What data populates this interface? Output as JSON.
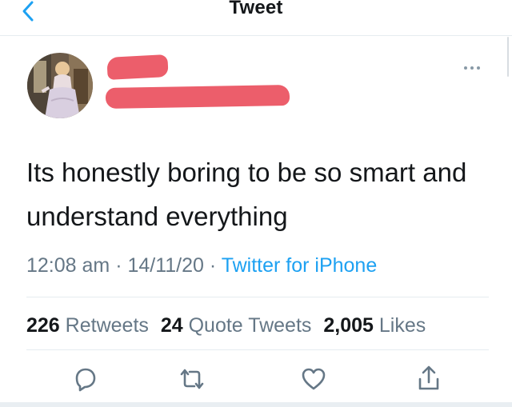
{
  "header": {
    "title": "Tweet",
    "back_icon": "chevron-left-icon",
    "accent": "#1da1f2"
  },
  "author": {
    "avatar_icon": "profile-avatar",
    "redaction_color": "#ec5e6b"
  },
  "tweet": {
    "line1": "Its honestly boring to be so smart and",
    "line2": "understand everything"
  },
  "meta": {
    "time": "12:08 am",
    "sep1": " · ",
    "date": "14/11/20",
    "sep2": " · ",
    "source": "Twitter for iPhone"
  },
  "stats": {
    "retweets_count": "226",
    "retweets_label": "Retweets",
    "quotes_count": "24",
    "quotes_label": "Quote Tweets",
    "likes_count": "2,005",
    "likes_label": "Likes"
  },
  "actions": [
    "reply-icon",
    "retweet-icon",
    "like-icon",
    "share-icon"
  ]
}
